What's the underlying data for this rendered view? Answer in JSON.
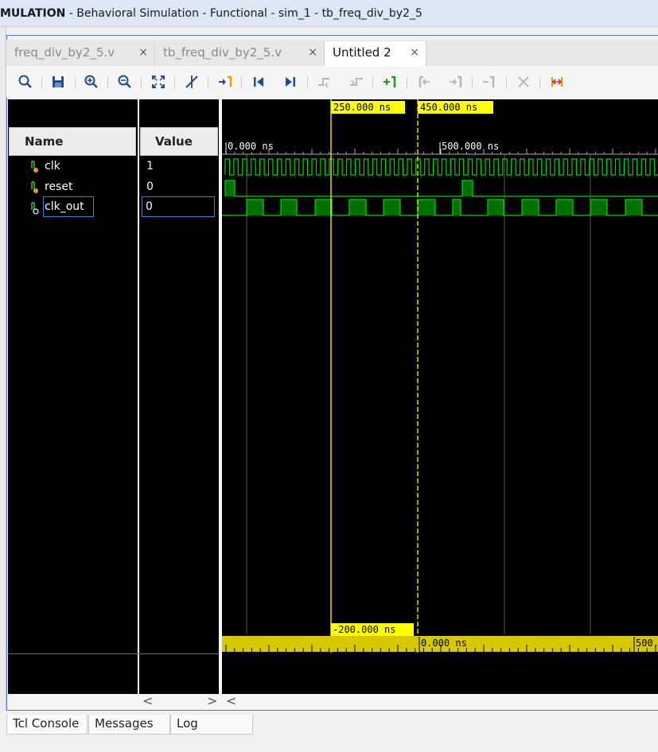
{
  "window": {
    "title_prefix": "MULATION",
    "title_rest": " - Behavioral Simulation - Functional - sim_1 - tb_freq_div_by2_5"
  },
  "tabs": [
    {
      "label": "freq_div_by2_5.v",
      "close": "×"
    },
    {
      "label": "tb_freq_div_by2_5.v",
      "close": "×"
    },
    {
      "label": "Untitled 2",
      "close": "×"
    }
  ],
  "toolbar": {
    "icons": [
      "search-icon",
      "save-icon",
      "zoom-in-icon",
      "zoom-out-icon",
      "zoom-fit-icon",
      "cursor-snap-icon",
      "go-to-zero-icon",
      "go-to-first-icon",
      "go-to-last-icon",
      "previous-transition-icon",
      "next-transition-icon",
      "add-marker-icon",
      "previous-marker-icon",
      "next-marker-icon",
      "swap-cursors-icon",
      "delete-marker-icon",
      "snap-range-icon"
    ]
  },
  "columns": {
    "name": "Name",
    "value": "Value"
  },
  "signals": [
    {
      "name": "clk",
      "value": "1"
    },
    {
      "name": "reset",
      "value": "0"
    },
    {
      "name": "clk_out",
      "value": "0"
    }
  ],
  "waveform": {
    "cursor_main": "250.000 ns",
    "cursor_secondary": "450.000 ns",
    "ruler_start": "0.000 ns",
    "ruler_mid": "500.000 ns",
    "delta_label": "-200.000 ns",
    "delta_zero": "0.000 ns",
    "delta_next": "500.",
    "colors": {
      "signal": "#00d800",
      "cursor": "#ffff00",
      "ruler": "#d8c800"
    }
  },
  "scroll": {
    "left": "<",
    "right": ">",
    "left2": "<"
  },
  "bottom_tabs": [
    "Tcl Console",
    "Messages",
    "Log"
  ]
}
